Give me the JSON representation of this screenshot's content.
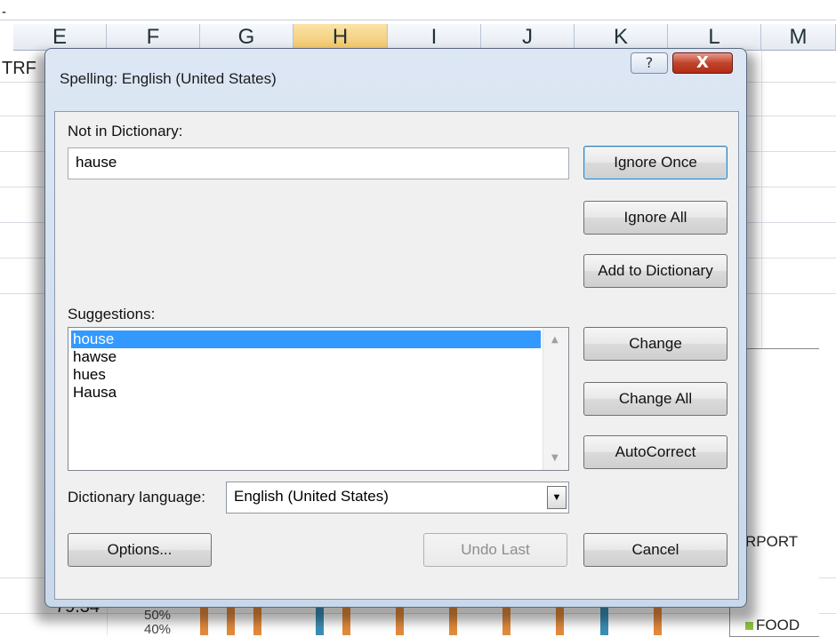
{
  "sheet": {
    "top_dash": "-",
    "columns": [
      "E",
      "F",
      "G",
      "H",
      "I",
      "J",
      "K",
      "L",
      "M"
    ],
    "selected_column": "H",
    "cell_trf": "TRF",
    "cell_value": "79.34",
    "axis_50": "50%",
    "axis_40": "40%",
    "chart_legend_rport": "RPORT",
    "chart_legend_food": "FOOD",
    "legend_food_color": "#8cc63f",
    "bar_orange": "#e28a3c",
    "bar_blue": "#3a8fb5"
  },
  "dialog": {
    "title": "Spelling: English (United States)",
    "help_glyph": "?",
    "close_glyph": "X",
    "not_in_dictionary_label": "Not in Dictionary:",
    "not_in_dictionary_value": "hause",
    "suggestions_label": "Suggestions:",
    "suggestions": [
      "house",
      "hawse",
      "hues",
      "Hausa"
    ],
    "selected_suggestion": "house",
    "dictionary_language_label": "Dictionary language:",
    "dictionary_language_value": "English (United States)",
    "buttons": {
      "ignore_once": "Ignore Once",
      "ignore_all": "Ignore All",
      "add_to_dictionary": "Add to Dictionary",
      "change": "Change",
      "change_all": "Change All",
      "autocorrect": "AutoCorrect",
      "options": "Options...",
      "undo_last": "Undo Last",
      "cancel": "Cancel"
    }
  }
}
